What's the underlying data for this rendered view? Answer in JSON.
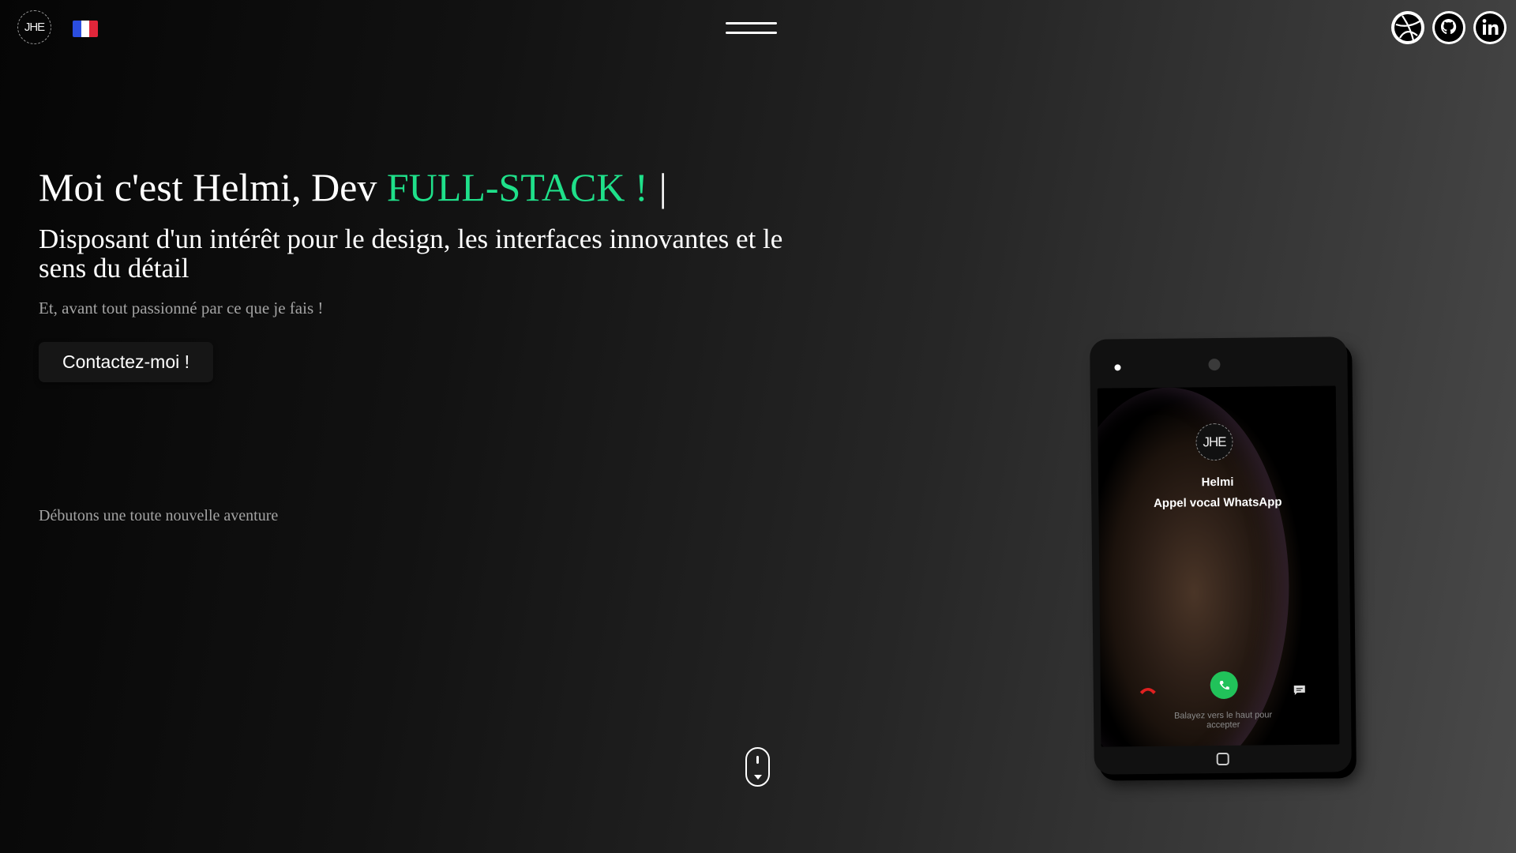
{
  "header": {
    "logo_text": "JHE",
    "flag_colors": [
      "#2b4ee0",
      "#ffffff",
      "#e0263a"
    ],
    "menu_icon": "hamburger-icon",
    "socials": [
      {
        "name": "dribbble",
        "icon": "dribbble-icon"
      },
      {
        "name": "github",
        "icon": "github-icon"
      },
      {
        "name": "linkedin",
        "icon": "linkedin-icon"
      }
    ]
  },
  "hero": {
    "title_prefix": "Moi c'est Helmi, Dev ",
    "title_accent": "FULL-STACK !",
    "caret": "|",
    "subtitle": "Disposant d'un intérêt pour le design, les interfaces innovantes et le sens du détail",
    "tagline": "Et, avant tout passionné par ce que je fais !",
    "cta_label": "Contactez-moi !",
    "adventure": "Débutons une toute nouvelle aventure",
    "accent_color": "#1fe08a"
  },
  "tablet": {
    "avatar_text": "JHE",
    "caller_name": "Helmi",
    "call_type": "Appel vocal WhatsApp",
    "swipe_hint": "Balayez vers le haut pour accepter",
    "accept_color": "#21c25a",
    "decline_color": "#e02020"
  },
  "scroll_indicator": "mouse-scroll-icon"
}
